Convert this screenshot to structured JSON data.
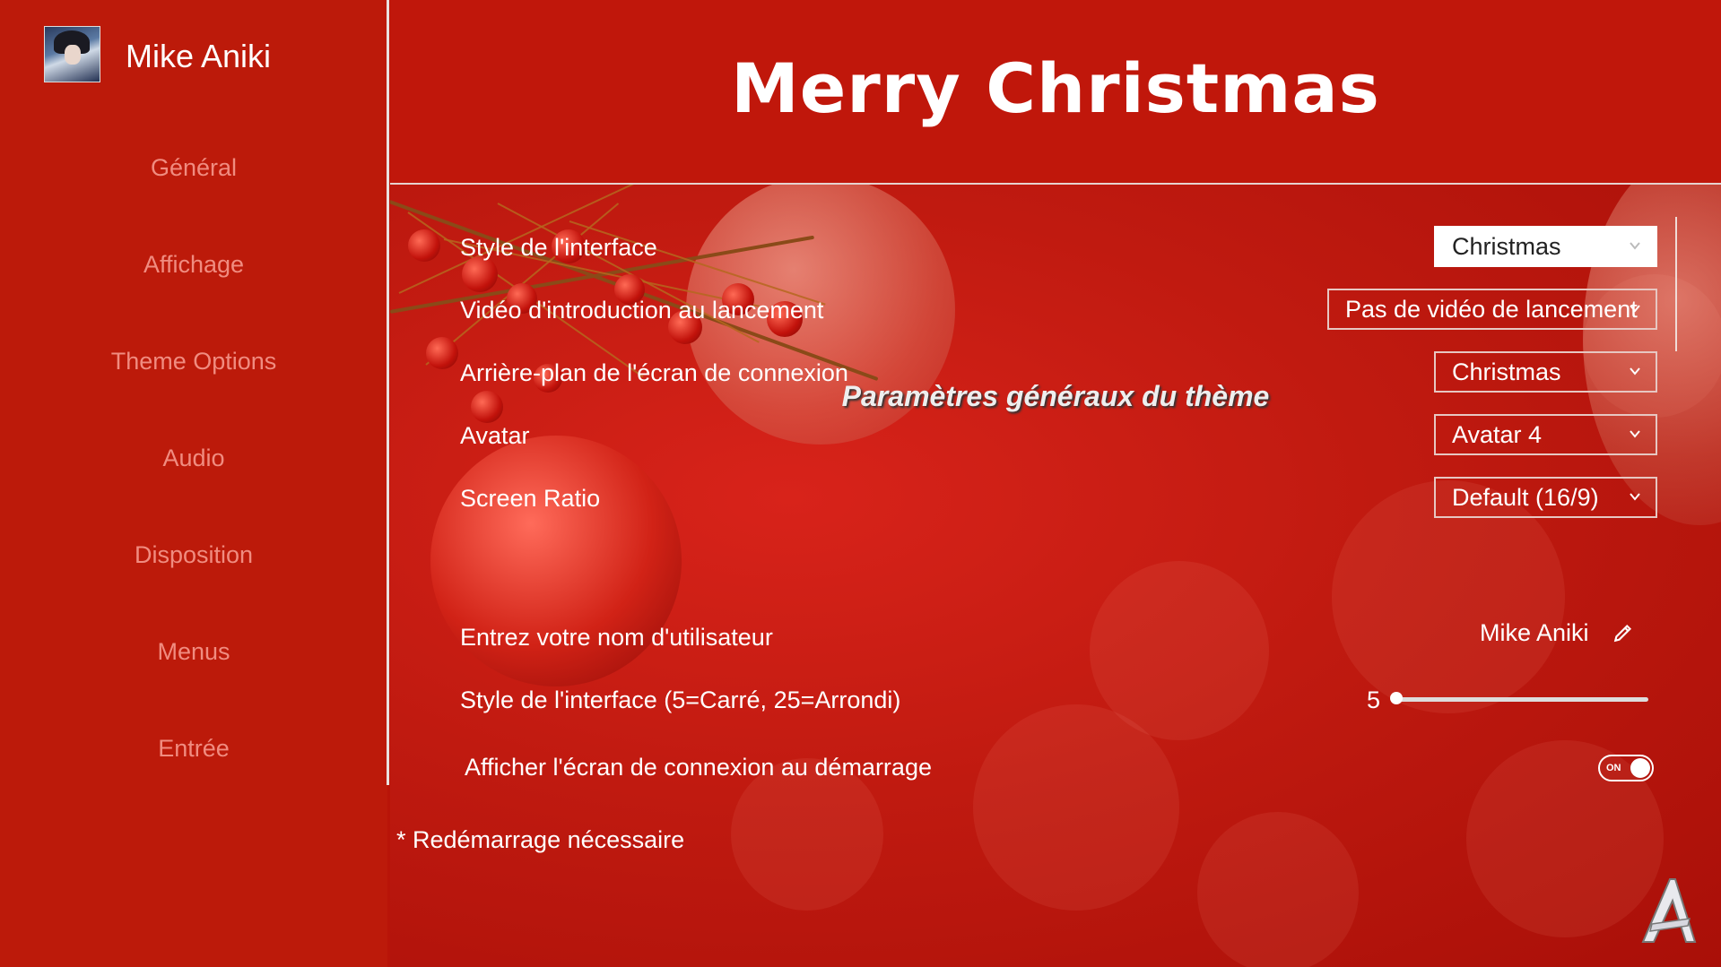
{
  "user": {
    "name": "Mike Aniki",
    "avatar_icon": "user-avatar"
  },
  "sidebar": {
    "items": [
      {
        "label": "Général"
      },
      {
        "label": "Affichage"
      },
      {
        "label": "Theme Options"
      },
      {
        "label": "Audio"
      },
      {
        "label": "Disposition"
      },
      {
        "label": "Menus"
      },
      {
        "label": "Entrée"
      }
    ]
  },
  "header": {
    "title": "Merry Christmas"
  },
  "settings": [
    {
      "label": "Style de l'interface",
      "value": "Christmas"
    },
    {
      "label": "Vidéo d'introduction au lancement",
      "value": "Pas de vidéo de lancement"
    },
    {
      "label": "Arrière-plan de l'écran de connexion",
      "value": "Christmas"
    },
    {
      "label": "Avatar",
      "value": "Avatar 4"
    },
    {
      "label": "Screen Ratio",
      "value": "Default (16/9)"
    }
  ],
  "theme_section": {
    "title": "Paramètres généraux du thème",
    "username_label": "Entrez votre nom d'utilisateur",
    "username_value": "Mike Aniki",
    "ui_style_label": "Style de l'interface (5=Carré, 25=Arrondi)",
    "ui_style_value": "5",
    "ui_style_slider": {
      "min": 5,
      "max": 25,
      "value": 5
    },
    "login_label": "Afficher l'écran de connexion au démarrage",
    "login_toggle": "ON"
  },
  "footer_note": "* Redémarrage nécessaire",
  "colors": {
    "background": "#b81408",
    "sidebar": "#bc1a0a",
    "nav_text": "#f08c80"
  }
}
